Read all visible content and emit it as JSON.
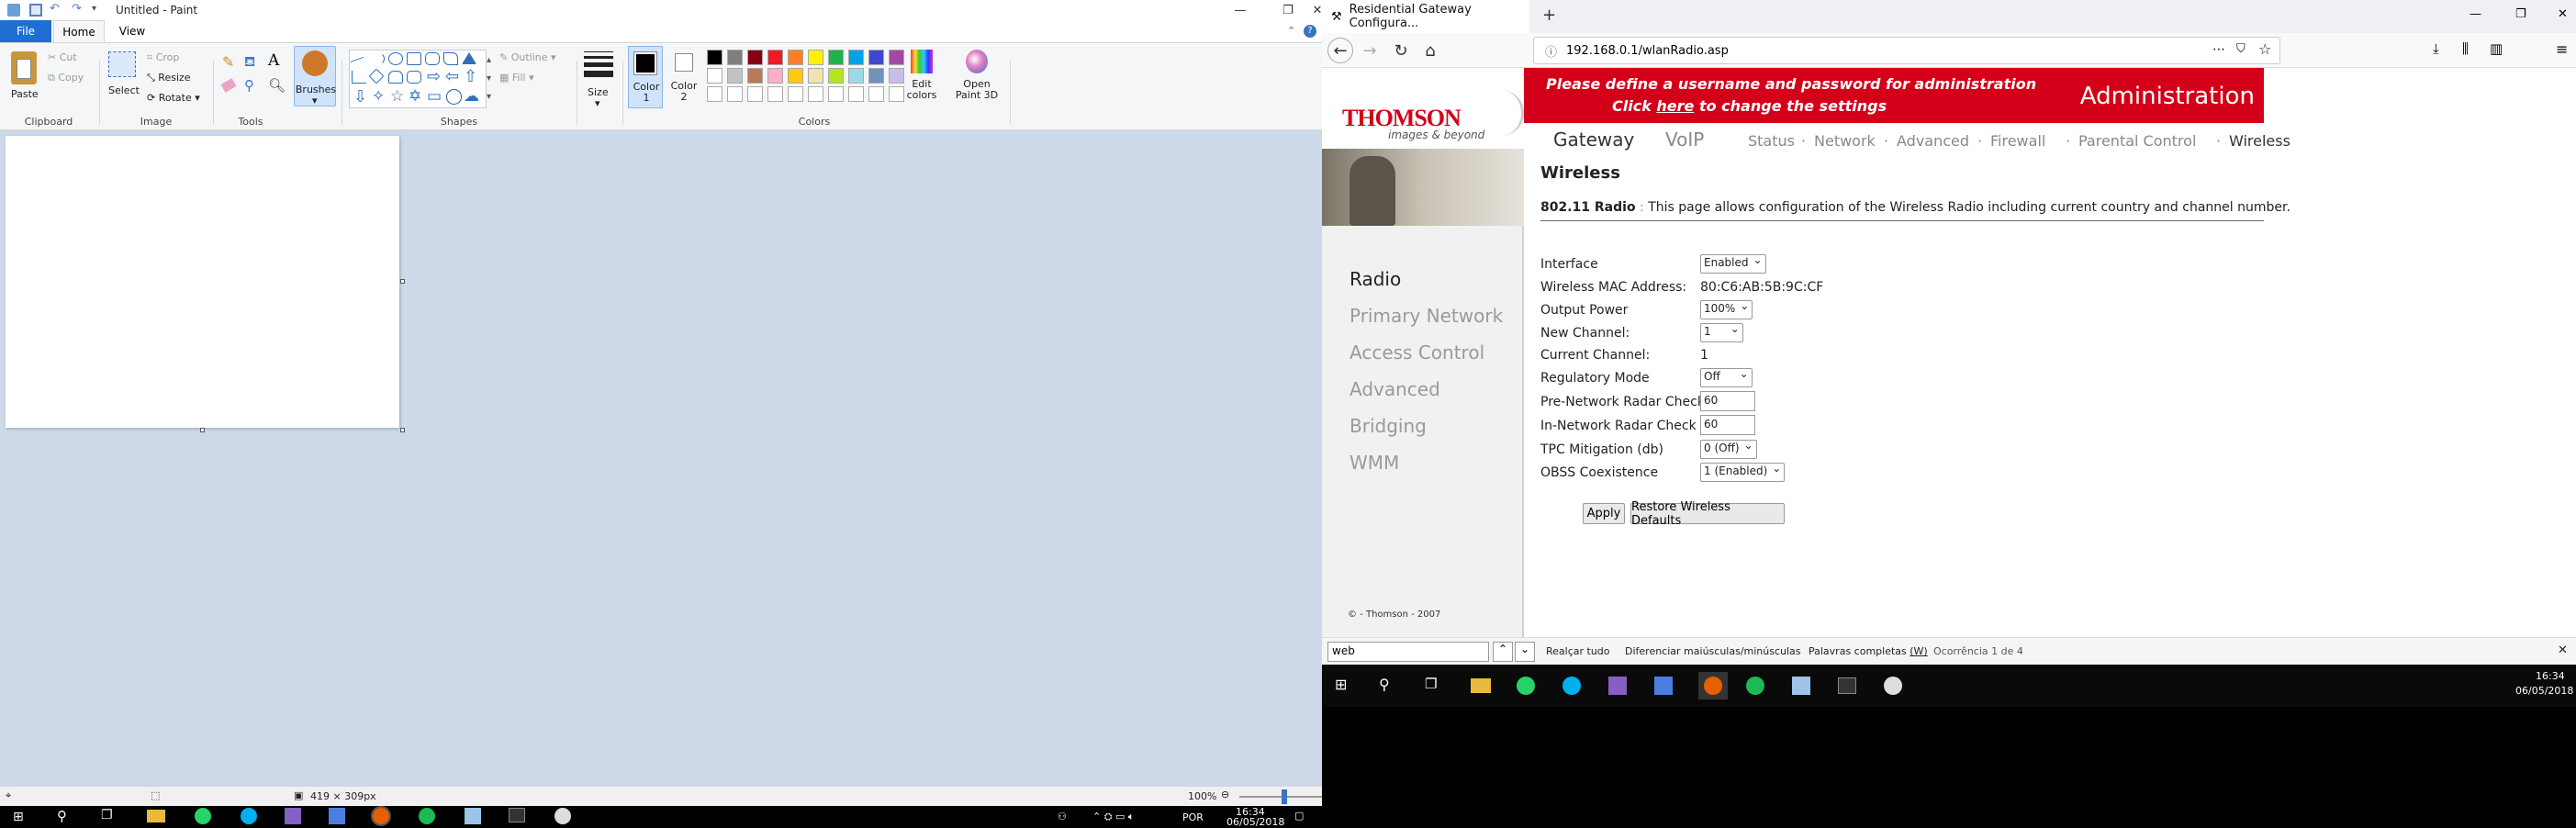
{
  "paint": {
    "title": "Untitled - Paint",
    "tabs": [
      "File",
      "Home",
      "View"
    ],
    "clipboard": {
      "paste": "Paste",
      "cut": "Cut",
      "copy": "Copy",
      "label": "Clipboard"
    },
    "image": {
      "select": "Select",
      "crop": "Crop",
      "resize": "Resize",
      "rotate": "Rotate",
      "label": "Image"
    },
    "tools": {
      "label": "Tools",
      "brushes": "Brushes"
    },
    "shapes": {
      "outline": "Outline",
      "fill": "Fill",
      "label": "Shapes"
    },
    "size": {
      "label": "Size"
    },
    "colors": {
      "color1": "Color 1",
      "color2": "Color 2",
      "edit": "Edit colors",
      "paint3d": "Open Paint 3D",
      "label": "Colors"
    },
    "palette": [
      "#000000",
      "#7f7f7f",
      "#880015",
      "#ed1c24",
      "#ff7f27",
      "#fff200",
      "#22b14c",
      "#00a2e8",
      "#3f48cc",
      "#a349a4",
      "#ffffff",
      "#c3c3c3",
      "#b97a57",
      "#ffaec9",
      "#ffc90e",
      "#efe4b0",
      "#b5e61d",
      "#99d9ea",
      "#7092be",
      "#c8bfe7"
    ],
    "status": {
      "dimensions": "419 × 309px",
      "zoom": "100%"
    },
    "taskbar": {
      "lang": "POR",
      "time": "16:34",
      "date": "06/05/2018"
    }
  },
  "firefox": {
    "tab_title": "Residential Gateway Configura...",
    "url": "192.168.0.1/wlanRadio.asp",
    "header": {
      "line1": "Please define a username and password for administration",
      "line2_pre": "Click ",
      "line2_link": "here",
      "line2_post": " to change the settings",
      "admin": "Administration",
      "brand": "THOMSON",
      "tagline": "images & beyond"
    },
    "nav": {
      "gateway": "Gateway",
      "voip": "VoIP",
      "links": [
        "Status",
        "Network",
        "Advanced",
        "Firewall",
        "Parental Control",
        "Wireless"
      ]
    },
    "section_title": "Wireless",
    "description_label": "802.11 Radio",
    "description_text": "This page allows configuration of the Wireless Radio including current country and channel number.",
    "sidebar": [
      "Radio",
      "Primary Network",
      "Access Control",
      "Advanced",
      "Bridging",
      "WMM"
    ],
    "copyright": "© - Thomson - 2007",
    "fields": [
      {
        "label": "Interface",
        "value": "Enabled"
      },
      {
        "label": "Wireless MAC Address:",
        "value": "80:C6:AB:5B:9C:CF"
      },
      {
        "label": "Output Power",
        "value": "100%"
      },
      {
        "label": "New Channel:",
        "value": "1"
      },
      {
        "label": "Current Channel:",
        "value": "1"
      },
      {
        "label": "Regulatory Mode",
        "value": "Off"
      },
      {
        "label": "Pre-Network Radar Check",
        "value": "60"
      },
      {
        "label": "In-Network Radar Check",
        "value": "60"
      },
      {
        "label": "TPC Mitigation (db)",
        "value": "0 (Off)"
      },
      {
        "label": "OBSS Coexistence",
        "value": "1 (Enabled)"
      }
    ],
    "buttons": {
      "apply": "Apply",
      "restore": "Restore Wireless Defaults"
    },
    "find": {
      "query": "web",
      "highlight": "Realçar tudo",
      "match_case": "Diferenciar maiúsculas/minúsculas",
      "whole": "Palavras completas",
      "whole_key": "(W)",
      "count": "Ocorrência 1 de 4"
    },
    "taskbar": {
      "time": "16:34",
      "date": "06/05/2018"
    }
  }
}
